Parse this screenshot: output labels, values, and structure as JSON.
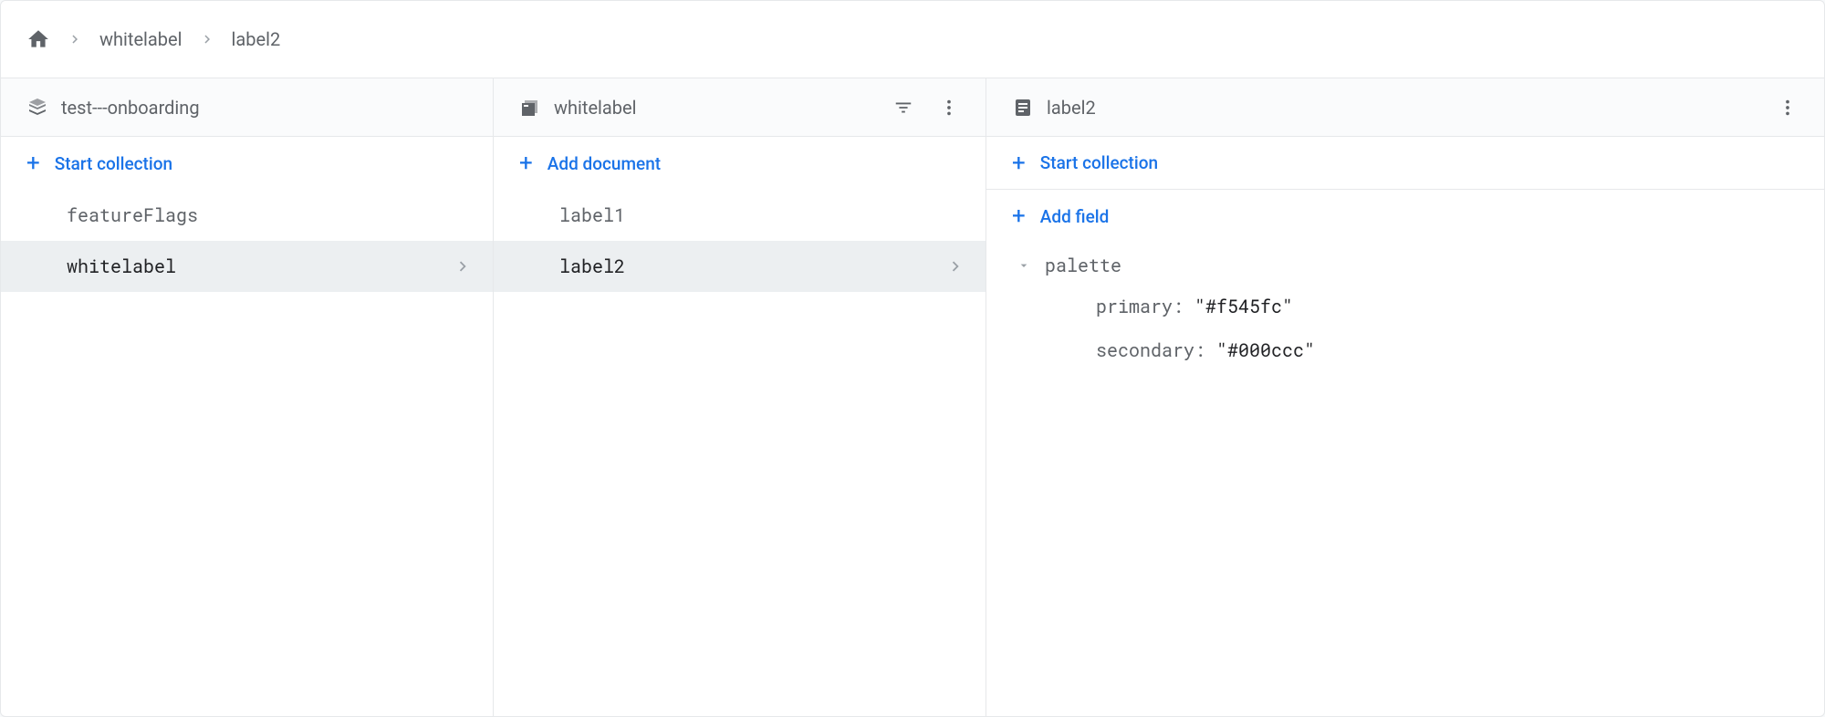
{
  "breadcrumb": {
    "items": [
      "whitelabel",
      "label2"
    ]
  },
  "columns": {
    "root": {
      "title": "test---onboarding",
      "action": "Start collection",
      "items": [
        {
          "label": "featureFlags",
          "selected": false
        },
        {
          "label": "whitelabel",
          "selected": true
        }
      ]
    },
    "collection": {
      "title": "whitelabel",
      "action": "Add document",
      "items": [
        {
          "label": "label1",
          "selected": false
        },
        {
          "label": "label2",
          "selected": true
        }
      ]
    },
    "document": {
      "title": "label2",
      "action_collection": "Start collection",
      "action_field": "Add field",
      "fields": {
        "palette": {
          "primary": "\"#f545fc\"",
          "secondary": "\"#000ccc\""
        }
      },
      "field_root_key": "palette",
      "field_child1_key": "primary",
      "field_child1_val": "\"#f545fc\"",
      "field_child2_key": "secondary",
      "field_child2_val": "\"#000ccc\""
    }
  }
}
